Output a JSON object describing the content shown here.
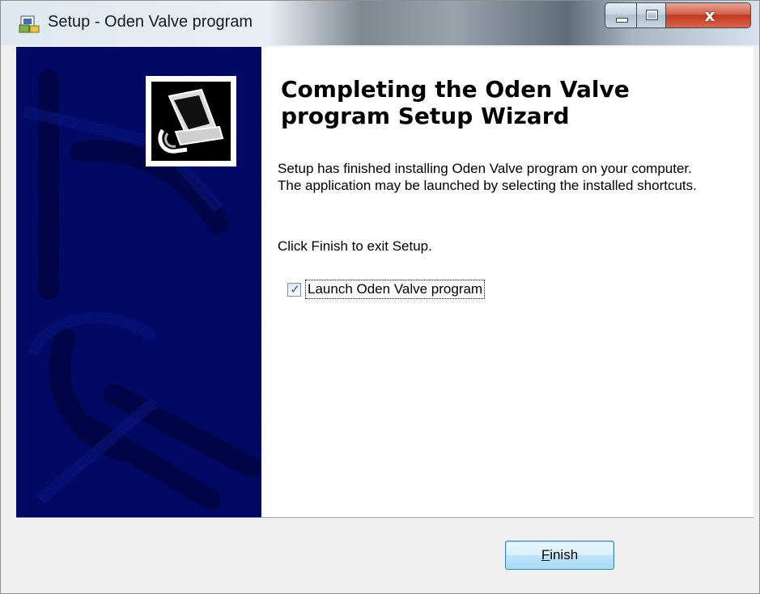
{
  "window": {
    "title": "Setup - Oden Valve program",
    "title_icon": "installer-icon",
    "controls": [
      "minimize-icon",
      "maximize-icon",
      "close-icon"
    ],
    "close_glyph": "x"
  },
  "wizard": {
    "heading": "Completing the Oden Valve program Setup Wizard",
    "message": "Setup has finished installing Oden Valve program on your computer. The application may be launched by selecting the installed shortcuts.",
    "exit_hint": "Click Finish to exit Setup.",
    "launch_checkbox": {
      "label": "Launch Oden Valve program",
      "checked": true,
      "check_glyph": "✓"
    },
    "sidebar_image": "computer-setup-icon"
  },
  "footer": {
    "finish_button": {
      "accel": "F",
      "rest": "inish"
    }
  },
  "colors": {
    "sidebar": "#000a6a",
    "close_button": "#c2371e",
    "button_border": "#3c7fb1"
  }
}
